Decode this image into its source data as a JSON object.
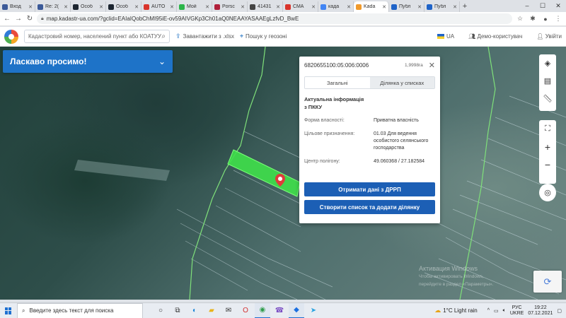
{
  "browser": {
    "tabs": [
      {
        "label": "Вход",
        "color": "#3b5998",
        "active": false
      },
      {
        "label": "Re: 2(",
        "color": "#3b5998",
        "active": false
      },
      {
        "label": "Особ",
        "color": "#1c2530",
        "active": false
      },
      {
        "label": "Особ",
        "color": "#1c2530",
        "active": false
      },
      {
        "label": "AUTO",
        "color": "#d9342b",
        "active": false
      },
      {
        "label": "Мой ",
        "color": "#2cb54a",
        "active": false
      },
      {
        "label": "Porsc",
        "color": "#b01f3a",
        "active": false
      },
      {
        "label": "41431",
        "color": "#444444",
        "active": false
      },
      {
        "label": "СМА",
        "color": "#d9342b",
        "active": false
      },
      {
        "label": "када",
        "color": "#4285f4",
        "active": false
      },
      {
        "label": "Kadа",
        "color": "#f09a2c",
        "active": true
      },
      {
        "label": "Публ",
        "color": "#1e63c8",
        "active": false
      },
      {
        "label": "Публ",
        "color": "#1e63c8",
        "active": false
      }
    ],
    "new_tab": "+",
    "url": "map.kadastr-ua.com/?gclid=EAIaIQobChMI95iE-ov59AIVGKp3Ch01aQ0NEAAYASAAEgLzfvD_BwE",
    "window_controls": [
      "–",
      "☐",
      "✕"
    ]
  },
  "site": {
    "search_placeholder": "Кадастровий номер, населений пункт або КОАТУУ",
    "upload_label": "Завантажити з .xlsx",
    "geo_search_label": "Пошук у геозоні",
    "lang": "UA",
    "demo_user": "Демо-користувач",
    "login": "Увійти"
  },
  "welcome": {
    "text": "Ласкаво просимо!"
  },
  "popup": {
    "cadastral_number": "6820655100:05:006:0006",
    "area": "1,9998га",
    "tabs": [
      "Загальні",
      "Ділянка у списках"
    ],
    "section_title": "Актуальна інформація з ПККУ",
    "rows": [
      {
        "key": "Форма власності:",
        "value": "Приватна власність"
      },
      {
        "key": "Цільове призначення:",
        "value": "01.03 Для ведення особистого селянського господарства"
      },
      {
        "key": "Центр полігону:",
        "value": "49.060368 / 27.182584"
      }
    ],
    "button_drrp": "Отримати дані з ДРРП",
    "button_list": "Створити список та додати ділянку"
  },
  "watermark": {
    "title": "Активация Windows",
    "subtitle": "Чтобы активировать Windows,",
    "subtitle2": "перейдите в раздел «Параметры»."
  },
  "taskbar": {
    "search_placeholder": "Введите здесь текст для поиска",
    "weather": "1°C  Light rain",
    "lang_top": "РУС",
    "lang_bottom": "UKRE",
    "time": "19:22",
    "date": "07.12.2021"
  },
  "icons": {
    "layers": "layers-icon",
    "print": "print-icon",
    "ruler": "ruler-icon",
    "fullscreen": "fullscreen-icon",
    "zoom_in": "zoom-in-icon",
    "zoom_out": "zoom-out-icon",
    "locate": "locate-icon"
  },
  "colors": {
    "accent": "#1e73c8",
    "button": "#1c5fb5",
    "parcel": "#3fe04a"
  }
}
